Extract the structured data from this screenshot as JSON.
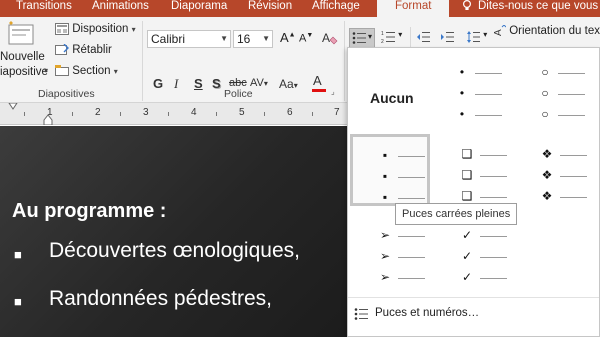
{
  "tabs": [
    {
      "id": "transitions",
      "label": "Transitions"
    },
    {
      "id": "animations",
      "label": "Animations"
    },
    {
      "id": "diaporama",
      "label": "Diaporama"
    },
    {
      "id": "revision",
      "label": "Révision"
    },
    {
      "id": "affichage",
      "label": "Affichage"
    },
    {
      "id": "format",
      "label": "Format"
    }
  ],
  "tell_me": "Dites-nous ce que vous v",
  "ribbon": {
    "diapositives": {
      "new_slide_line1": "Nouvelle",
      "new_slide_line2": "iapositive",
      "disposition": "Disposition",
      "retablir": "Rétablir",
      "section": "Section",
      "group_label": "Diapositives"
    },
    "police": {
      "font_name": "Calibri",
      "font_size": "16",
      "bold": "G",
      "italic": "I",
      "underline": "S",
      "shadow": "S",
      "strike": "abc",
      "spacing": "AV",
      "case": "Aa",
      "color": "A",
      "group_label": "Police",
      "grow": "A",
      "shrink": "A"
    },
    "paragraphe": {
      "orientation": "Orientation du text"
    }
  },
  "ruler": {
    "numbers": [
      "1",
      "2",
      "3",
      "4",
      "5",
      "6",
      "7"
    ]
  },
  "slide": {
    "title": "Au programme :",
    "bullet_symbol": "■",
    "items": [
      "Découvertes œnologiques,",
      "Randonnées pédestres,"
    ]
  },
  "gallery": {
    "none_label": "Aucun",
    "tooltip": "Puces carrées pleines",
    "footer_label": "Puces et numéros…",
    "cells": [
      {
        "name": "small-dot",
        "symbol": "•"
      },
      {
        "name": "hollow-circle",
        "symbol": "○"
      },
      {
        "name": "filled-square",
        "symbol": "▪"
      },
      {
        "name": "hollow-square",
        "symbol": "❑"
      },
      {
        "name": "diamond-cluster",
        "symbol": "❖"
      },
      {
        "name": "arrow",
        "symbol": "➢"
      },
      {
        "name": "checkmark",
        "symbol": "✓"
      }
    ]
  },
  "colors": {
    "accent": "#b7472a",
    "font_color_bar": "#e01010",
    "ribbon_bg": "#f3f3f3"
  }
}
